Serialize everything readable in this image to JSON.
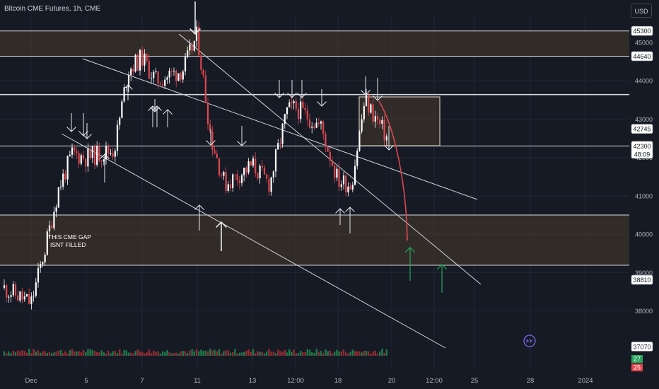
{
  "header": {
    "title": "Bitcoin CME Futures, 1h, CME",
    "currency": "USD"
  },
  "colors": {
    "background": "#161a25",
    "bull_candle": "#ffffff",
    "bear_candle": "#e0474e",
    "zone_fill": "#4a3c2e",
    "projection": "#e0474e",
    "target_arrow": "#26a65b",
    "grid": "#232734"
  },
  "chart_data": {
    "type": "candlestick",
    "title": "Bitcoin CME Futures, 1h, CME",
    "timeframe": "1h",
    "x_tick_labels": [
      "Dec",
      "5",
      "7",
      "11",
      "13",
      "12:00",
      "18",
      "20",
      "12:00",
      "25",
      "28",
      "2024"
    ],
    "y_tick_labels": [
      45000,
      44000,
      43000,
      42000,
      41000,
      40000,
      39000,
      38000
    ],
    "ylim": [
      36700,
      45700
    ],
    "price_tags": [
      {
        "label": "45300",
        "style": "level"
      },
      {
        "label": "44640",
        "style": "level"
      },
      {
        "label": "42745",
        "style": "level"
      },
      {
        "label": "42300",
        "style": "current",
        "countdown": "48:09"
      },
      {
        "label": "38810",
        "style": "level"
      },
      {
        "label": "37070",
        "style": "level"
      }
    ],
    "horizontal_levels": [
      45300,
      44640,
      43640,
      42300,
      40500,
      39190
    ],
    "zones": [
      {
        "from": 44640,
        "to": 45300
      },
      {
        "from": 39190,
        "to": 40500
      }
    ],
    "annotation": [
      "THIS CME GAP",
      "ISNT FILLED"
    ],
    "price_path_approx": [
      {
        "x": "Nov 29",
        "close": 38600
      },
      {
        "x": "Dec 1",
        "close": 38200
      },
      {
        "x": "Dec 2",
        "close": 39600
      },
      {
        "x": "Dec 3",
        "close": 41200
      },
      {
        "x": "Dec 4",
        "close": 42100
      },
      {
        "x": "Dec 5",
        "close": 42000
      },
      {
        "x": "Dec 6",
        "close": 42200
      },
      {
        "x": "Dec 6 12:00",
        "close": 44300
      },
      {
        "x": "Dec 7",
        "close": 44600
      },
      {
        "x": "Dec 8",
        "close": 44000
      },
      {
        "x": "Dec 10",
        "close": 44300
      },
      {
        "x": "Dec 11",
        "close": 45200
      },
      {
        "x": "Dec 11 12:00",
        "close": 42500
      },
      {
        "x": "Dec 12",
        "close": 41300
      },
      {
        "x": "Dec 13",
        "close": 41800
      },
      {
        "x": "Dec 14",
        "close": 41300
      },
      {
        "x": "Dec 15",
        "close": 43200
      },
      {
        "x": "Dec 15 12:00",
        "close": 43300
      },
      {
        "x": "Dec 17",
        "close": 42800
      },
      {
        "x": "Dec 18",
        "close": 41400
      },
      {
        "x": "Dec 18 12:00",
        "close": 41300
      },
      {
        "x": "Dec 19",
        "close": 43500
      },
      {
        "x": "Dec 20",
        "close": 42300
      }
    ],
    "volume_badges": [
      {
        "label": "27",
        "color": "#26a65b"
      },
      {
        "label": "25",
        "color": "#e0474e"
      }
    ],
    "grid": true
  }
}
